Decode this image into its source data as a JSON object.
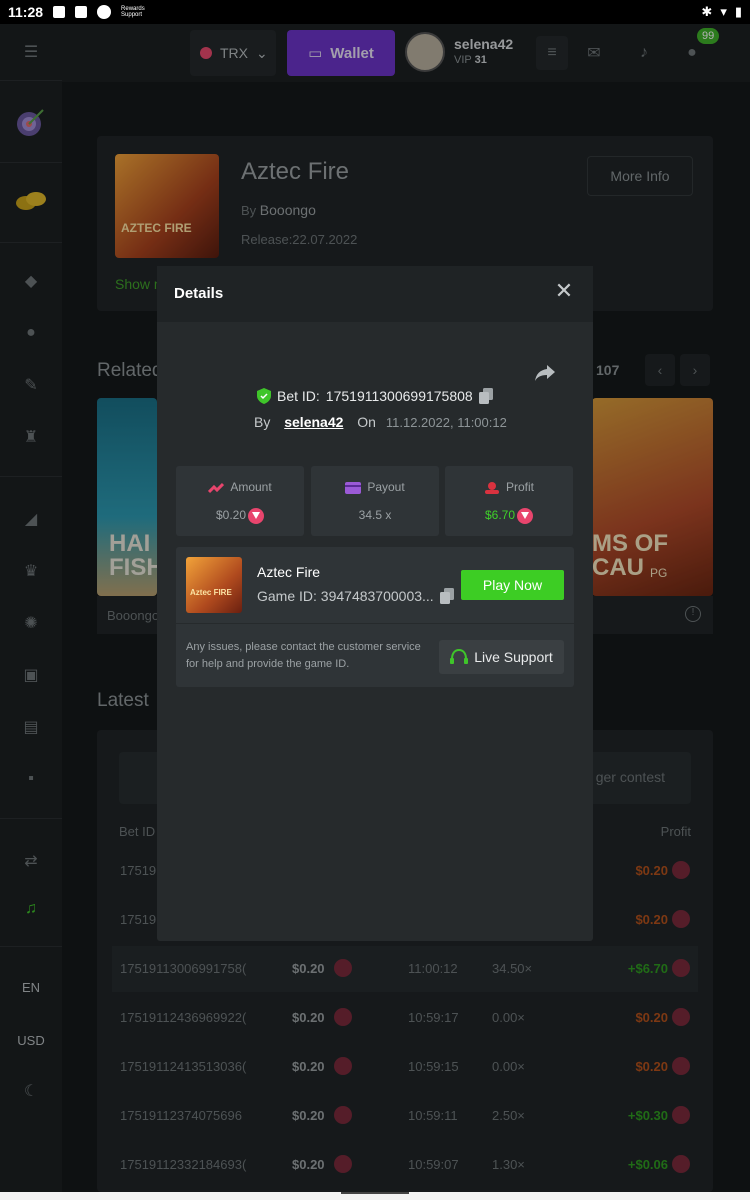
{
  "status_bar": {
    "time": "11:28",
    "small_text": "Rewards Support"
  },
  "sidebar": {
    "items": [
      {
        "icon": "menu-icon"
      },
      {
        "icon": "target-icon"
      },
      {
        "icon": "coins-icon"
      },
      {
        "icon": "dice-icon"
      },
      {
        "icon": "basketball-icon"
      },
      {
        "icon": "ticket-icon"
      },
      {
        "icon": "trophy-icon"
      },
      {
        "icon": "promo-icon"
      },
      {
        "icon": "crown-icon"
      },
      {
        "icon": "spin-icon"
      },
      {
        "icon": "gamepad-icon"
      },
      {
        "icon": "partner-icon"
      },
      {
        "icon": "chat-icon"
      },
      {
        "icon": "handshake-icon"
      },
      {
        "icon": "headset-icon"
      }
    ],
    "lang": "EN",
    "currency": "USD"
  },
  "topbar": {
    "coin": "TRX",
    "wallet_label": "Wallet",
    "username": "selena42",
    "vip_label": "VIP",
    "vip_level": "31",
    "badge_count": "99"
  },
  "game_info": {
    "title": "Aztec Fire",
    "by_label": "By",
    "provider": "Booongo",
    "release": "Release:22.07.2022",
    "more_info": "More Info",
    "show_more": "Show m",
    "thumb_text": "AZTEC FIRE"
  },
  "related": {
    "title": "Related",
    "count": "107",
    "left_text": "HAI FISH",
    "left_provider": "Booongo",
    "right_text": "MS OF CAU",
    "right_logo": "PG"
  },
  "latest": {
    "title": "Latest",
    "tab": "ger contest",
    "col_betid": "Bet ID",
    "col_profit": "Profit",
    "rows": [
      {
        "id": "17519",
        "amount": "",
        "time": "",
        "payout": "",
        "profit": "$0.20",
        "positive": false
      },
      {
        "id": "17519",
        "amount": "",
        "time": "",
        "payout": "",
        "profit": "$0.20",
        "positive": false
      },
      {
        "id": "17519113006991758(",
        "amount": "$0.20",
        "time": "11:00:12",
        "payout": "34.50×",
        "profit": "+$6.70",
        "positive": true
      },
      {
        "id": "17519112436969922(",
        "amount": "$0.20",
        "time": "10:59:17",
        "payout": "0.00×",
        "profit": "$0.20",
        "positive": false
      },
      {
        "id": "17519112413513036(",
        "amount": "$0.20",
        "time": "10:59:15",
        "payout": "0.00×",
        "profit": "$0.20",
        "positive": false
      },
      {
        "id": "17519112374075696",
        "amount": "$0.20",
        "time": "10:59:11",
        "payout": "2.50×",
        "profit": "+$0.30",
        "positive": true
      },
      {
        "id": "17519112332184693(",
        "amount": "$0.20",
        "time": "10:59:07",
        "payout": "1.30×",
        "profit": "+$0.06",
        "positive": true
      }
    ]
  },
  "modal": {
    "title": "Details",
    "bet_id_label": "Bet ID:",
    "bet_id": "1751911300699175808",
    "by_label": "By",
    "user": "selena42",
    "on_label": "On",
    "datetime": "11.12.2022, 11:00:12",
    "stats": {
      "amount_label": "Amount",
      "amount_value": "$0.20",
      "payout_label": "Payout",
      "payout_value": "34.5 x",
      "profit_label": "Profit",
      "profit_value": "$6.70"
    },
    "game_name": "Aztec Fire",
    "game_id": "Game ID: 3947483700003...",
    "play_now": "Play Now",
    "note": "Any issues, please contact the customer service for help and provide the game ID.",
    "live_support": "Live Support",
    "thumb_text": "Aztec FIRE"
  },
  "colors": {
    "accent_purple": "#6c34c9",
    "accent_green": "#3dcd24",
    "profit_green": "#3fd02a",
    "loss_orange": "#b3511c",
    "tron_red": "#e8456d"
  }
}
